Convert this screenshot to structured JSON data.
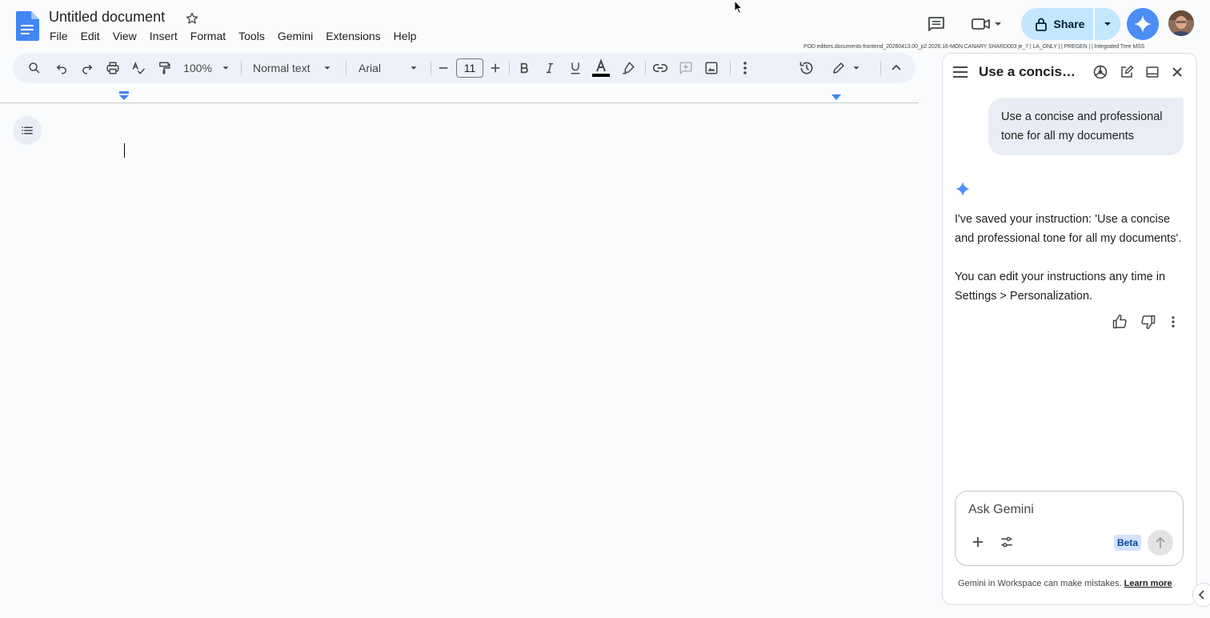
{
  "app": {
    "doc_title": "Untitled document",
    "build_info": "POD editors.documents-frontend_20260413.00_p2 2026.16-MON CANARY SHARD003 je_7 | LA_ONLY |  | PREGEN |  | Integrated Tree   MSS"
  },
  "menu": {
    "items": [
      "File",
      "Edit",
      "View",
      "Insert",
      "Format",
      "Tools",
      "Gemini",
      "Extensions",
      "Help"
    ]
  },
  "header": {
    "share_label": "Share"
  },
  "toolbar": {
    "zoom": "100%",
    "style": "Normal text",
    "font": "Arial",
    "font_size": "11",
    "text_color": "#000000"
  },
  "panel": {
    "title": "Use a concise and professional tone for all my documents",
    "user_message": "Use a concise and professional tone for all my documents",
    "response_1": "I've saved your instruction: 'Use a concise and professional tone for all my documents'.",
    "response_2": "You can edit your instructions any time in Settings > Personalization.",
    "input_placeholder": "Ask Gemini",
    "beta_label": "Beta",
    "disclaimer": "Gemini in Workspace can make mistakes.",
    "learn_more": "Learn more"
  },
  "colors": {
    "accent": "#0b57d0",
    "share_bg": "#c2e7ff",
    "gemini_blue": "#4c8df6"
  }
}
